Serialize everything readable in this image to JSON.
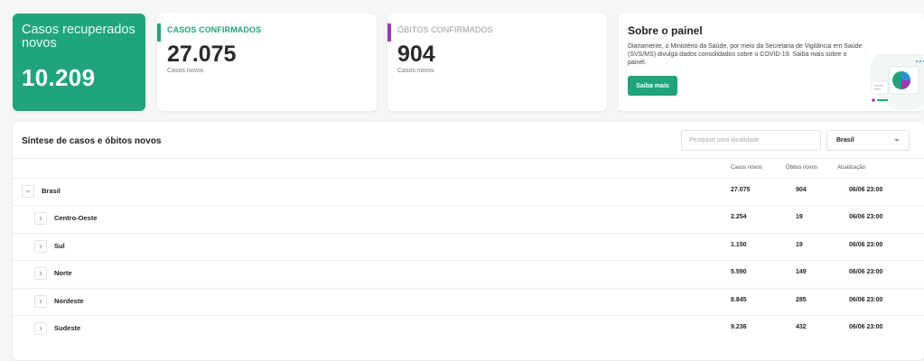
{
  "recovered": {
    "label": "Casos recuperados novos",
    "value": "10.209"
  },
  "confirmed": {
    "title": "CASOS CONFIRMADOS",
    "value": "27.075",
    "sub": "Casos novos",
    "color": "#1fa47b"
  },
  "deaths": {
    "title": "ÓBITOS CONFIRMADOS",
    "value": "904",
    "sub": "Casos novos",
    "color": "#9b3bb5"
  },
  "about": {
    "title": "Sobre o painel",
    "description": "Diariamente, o Ministério da Saúde, por meio da Secretaria de Vigilância em Saúde (SVS/MS) divulga dados consolidados sobre o COVID-19. Saiba mais sobre o painel.",
    "button": "Saiba mais"
  },
  "table": {
    "title": "Síntese de casos e óbitos novos",
    "search_placeholder": "Pesquise uma localidade",
    "select_value": "Brasil",
    "columns": [
      "Casos novos",
      "Óbitos novos",
      "Atualização"
    ],
    "rows": [
      {
        "name": "Brasil",
        "cases": "27.075",
        "deaths": "904",
        "updated": "06/06 23:00",
        "level": 0,
        "expanded": true
      },
      {
        "name": "Centro-Oeste",
        "cases": "2.254",
        "deaths": "19",
        "updated": "06/06 23:00",
        "level": 1,
        "expanded": false
      },
      {
        "name": "Sul",
        "cases": "1.150",
        "deaths": "19",
        "updated": "06/06 23:00",
        "level": 1,
        "expanded": false
      },
      {
        "name": "Norte",
        "cases": "5.590",
        "deaths": "149",
        "updated": "06/06 23:00",
        "level": 1,
        "expanded": false
      },
      {
        "name": "Nordeste",
        "cases": "8.845",
        "deaths": "285",
        "updated": "06/06 23:00",
        "level": 1,
        "expanded": false
      },
      {
        "name": "Sudeste",
        "cases": "9.236",
        "deaths": "432",
        "updated": "06/06 23:00",
        "level": 1,
        "expanded": false
      }
    ]
  }
}
